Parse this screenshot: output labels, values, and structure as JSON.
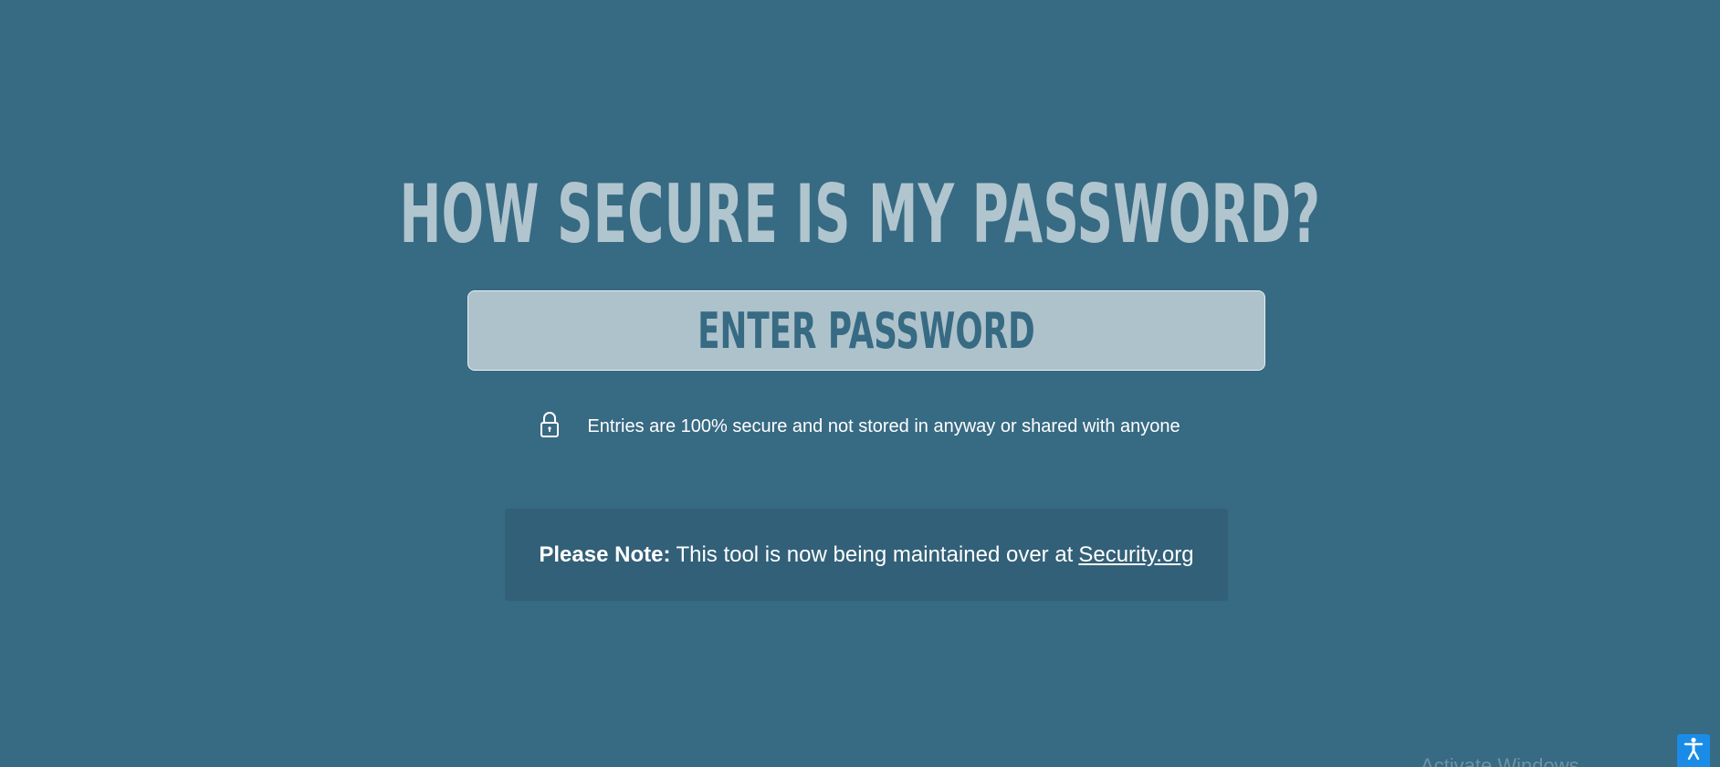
{
  "header": {
    "title": "HOW SECURE IS MY PASSWORD?"
  },
  "password_input": {
    "placeholder": "ENTER PASSWORD",
    "value": ""
  },
  "security_notice": {
    "icon": "lock-icon",
    "text": "Entries are 100% secure and not stored in anyway or shared with anyone"
  },
  "note": {
    "label": "Please Note:",
    "text": "This tool is now being maintained over at",
    "link_text": "Security.org"
  },
  "watermark": {
    "text": "Activate Windows"
  },
  "accessibility": {
    "icon": "accessibility-icon"
  },
  "colors": {
    "background": "#376a83",
    "title": "#b1c5cf",
    "input_bg": "#aec2cb",
    "note_bg": "#326078",
    "accessibility_button": "#1a8ce8"
  }
}
